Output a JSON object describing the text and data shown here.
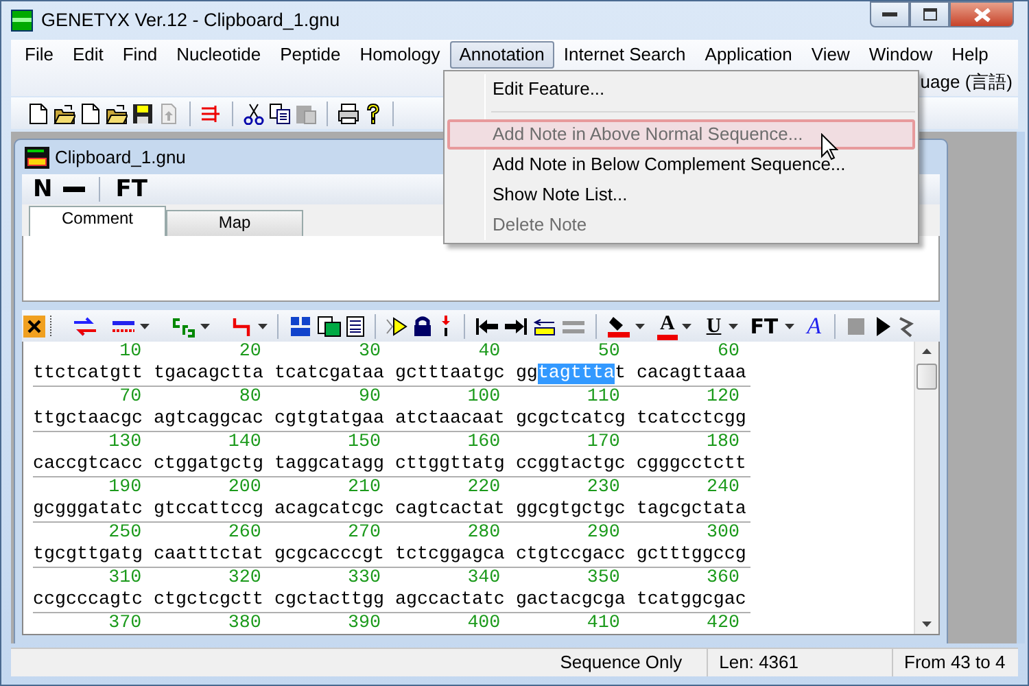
{
  "window": {
    "title": "GENETYX Ver.12 - Clipboard_1.gnu"
  },
  "menu_bar": [
    {
      "label": "File",
      "selected": false
    },
    {
      "label": "Edit",
      "selected": false
    },
    {
      "label": "Find",
      "selected": false
    },
    {
      "label": "Nucleotide",
      "selected": false
    },
    {
      "label": "Peptide",
      "selected": false
    },
    {
      "label": "Homology",
      "selected": false
    },
    {
      "label": "Annotation",
      "selected": true
    },
    {
      "label": "Internet Search",
      "selected": false
    },
    {
      "label": "Application",
      "selected": false
    },
    {
      "label": "View",
      "selected": false
    },
    {
      "label": "Window",
      "selected": false
    },
    {
      "label": "Help",
      "selected": false
    }
  ],
  "menu_bar_overflow": "uage (言語)",
  "annotation_menu": [
    {
      "kind": "item",
      "label": "Edit Feature...",
      "selected": false,
      "disabled": false
    },
    {
      "kind": "separator"
    },
    {
      "kind": "item",
      "label": "Add Note in Above Normal Sequence...",
      "selected": true,
      "disabled": true
    },
    {
      "kind": "item",
      "label": "Add Note in Below Complement Sequence...",
      "selected": false,
      "disabled": false
    },
    {
      "kind": "item",
      "label": "Show Note List...",
      "selected": false,
      "disabled": false
    },
    {
      "kind": "item",
      "label": "Delete Note",
      "selected": false,
      "disabled": true
    }
  ],
  "document": {
    "title": "Clipboard_1.gnu",
    "toolbar": [
      "N",
      "FT"
    ],
    "tabs": [
      {
        "label": "Comment",
        "selected": true
      },
      {
        "label": "Map",
        "selected": false
      }
    ],
    "sequence_toolbar_labels": [
      "A",
      "U",
      "FT",
      "A"
    ],
    "lines": [
      {
        "numbers": [
          "10",
          "20",
          "30",
          "40",
          "50",
          "60"
        ],
        "blocks": [
          "ttctcatgtt",
          "tgacagctta",
          "tcatcgataa",
          "gctttaatgc",
          [
            {
              "text": "gg",
              "selected": false
            },
            {
              "text": "tagttta",
              "selected": true
            },
            {
              "text": "t",
              "selected": false
            }
          ],
          "cacagttaaa"
        ]
      },
      {
        "numbers": [
          "70",
          "80",
          "90",
          "100",
          "110",
          "120"
        ],
        "blocks": [
          "ttgctaacgc",
          "agtcaggcac",
          "cgtgtatgaa",
          "atctaacaat",
          "gcgctcatcg",
          "tcatcctcgg"
        ]
      },
      {
        "numbers": [
          "130",
          "140",
          "150",
          "160",
          "170",
          "180"
        ],
        "blocks": [
          "caccgtcacc",
          "ctggatgctg",
          "taggcatagg",
          "cttggttatg",
          "ccggtactgc",
          "cgggcctctt"
        ]
      },
      {
        "numbers": [
          "190",
          "200",
          "210",
          "220",
          "230",
          "240"
        ],
        "blocks": [
          "gcgggatatc",
          "gtccattccg",
          "acagcatcgc",
          "cagtcactat",
          "ggcgtgctgc",
          "tagcgctata"
        ]
      },
      {
        "numbers": [
          "250",
          "260",
          "270",
          "280",
          "290",
          "300"
        ],
        "blocks": [
          "tgcgttgatg",
          "caatttctat",
          "gcgcacccgt",
          "tctcggagca",
          "ctgtccgacc",
          "gctttggccg"
        ]
      },
      {
        "numbers": [
          "310",
          "320",
          "330",
          "340",
          "350",
          "360"
        ],
        "blocks": [
          "ccgcccagtc",
          "ctgctcgctt",
          "cgctacttgg",
          "agccactatc",
          "gactacgcga",
          "tcatggcgac"
        ]
      },
      {
        "numbers": [
          "370",
          "380",
          "390",
          "400",
          "410",
          "420"
        ]
      }
    ]
  },
  "status_bar": [
    "Sequence Only",
    "Len: 4361",
    "From 43 to 4"
  ]
}
